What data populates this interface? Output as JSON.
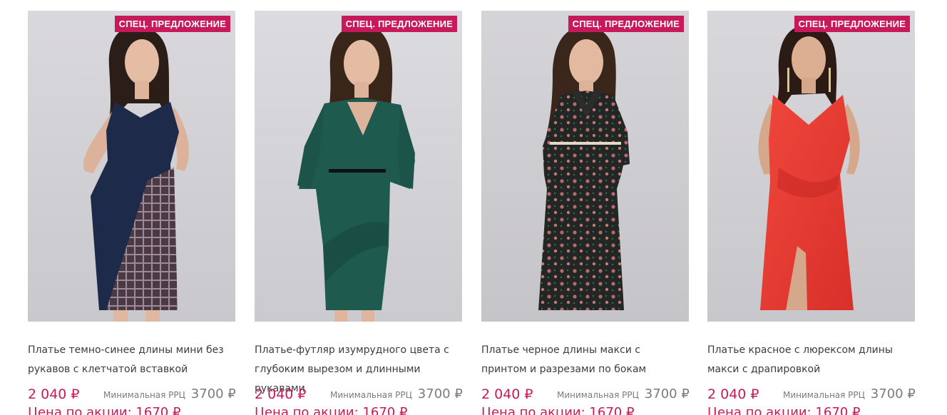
{
  "badge_label": "СПЕЦ. ПРЕДЛОЖЕНИЕ",
  "rrc_label": "Минимальная РРЦ",
  "promo_label": "Цена по акции:",
  "currency": "₽",
  "colors": {
    "accent": "#c8195b",
    "text": "#3c3c3c",
    "muted": "#7b7b7b"
  },
  "products": [
    {
      "title": "Платье темно-синее длины мини без рукавов с клетчатой вставкой",
      "price": "2 040 ₽",
      "rrc": "3700 ₽",
      "promo_price": "1670 ₽",
      "dress_color": "#1e2a4a"
    },
    {
      "title": "Платье-футляр изумрудного цвета с глубоким вырезом и длинными рукавами",
      "price": "2 040 ₽",
      "rrc": "3700 ₽",
      "promo_price": "1670 ₽",
      "dress_color": "#1f5a4f"
    },
    {
      "title": "Платье черное длины макси с принтом и разрезами по бокам",
      "price": "2 040 ₽",
      "rrc": "3700 ₽",
      "promo_price": "1670 ₽",
      "dress_color": "#2a2a2a"
    },
    {
      "title": "Платье красное с люрексом длины макси с драпировкой",
      "price": "2 040 ₽",
      "rrc": "3700 ₽",
      "promo_price": "1670 ₽",
      "dress_color": "#e8392f"
    }
  ]
}
